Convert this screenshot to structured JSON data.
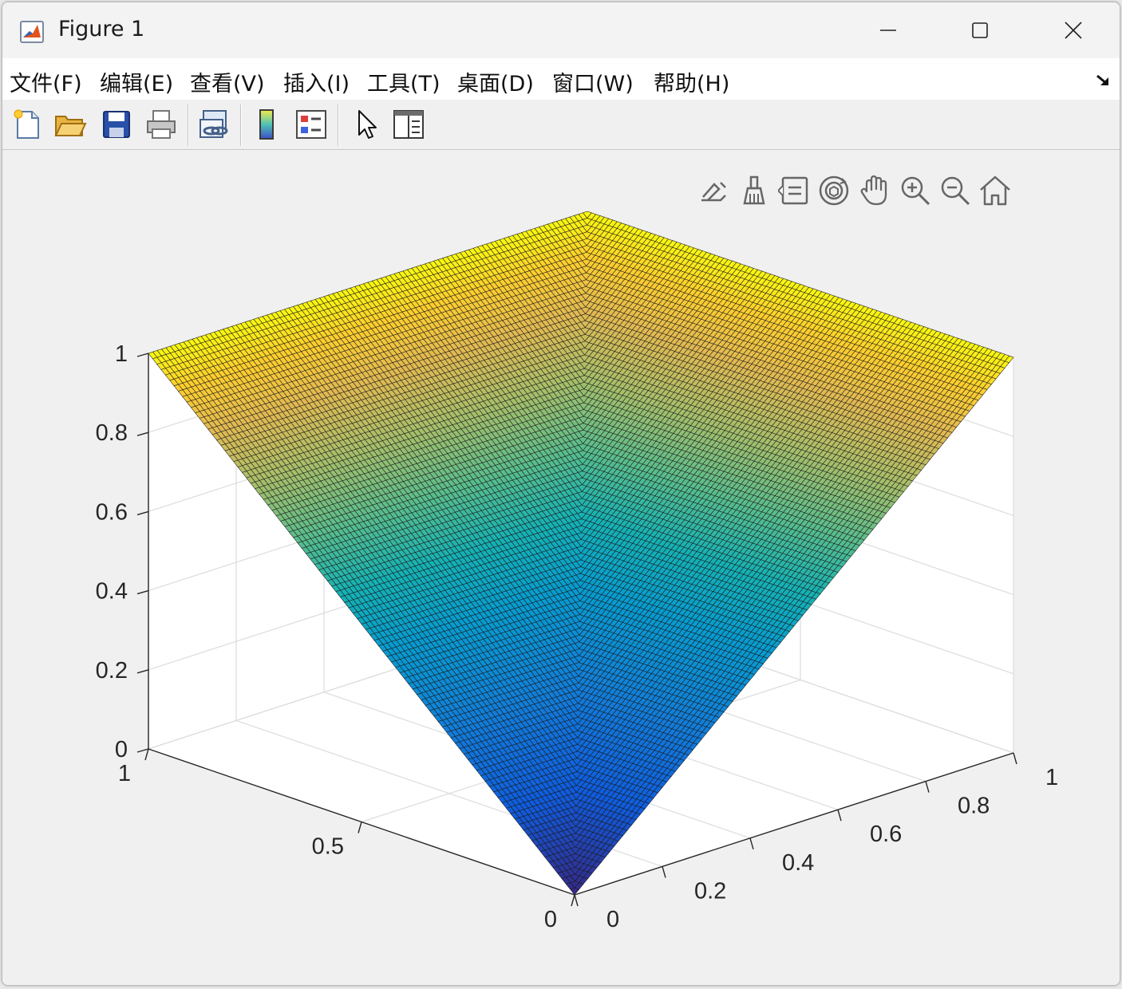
{
  "window": {
    "title": "Figure 1"
  },
  "menu": {
    "items": [
      {
        "label": "文件(F)",
        "name": "menu-file"
      },
      {
        "label": "编辑(E)",
        "name": "menu-edit"
      },
      {
        "label": "查看(V)",
        "name": "menu-view"
      },
      {
        "label": "插入(I)",
        "name": "menu-insert"
      },
      {
        "label": "工具(T)",
        "name": "menu-tools"
      },
      {
        "label": "桌面(D)",
        "name": "menu-desktop"
      },
      {
        "label": "窗口(W)",
        "name": "menu-window"
      },
      {
        "label": "帮助(H)",
        "name": "menu-help"
      }
    ]
  },
  "toolbar": {
    "icons": [
      "new-figure-icon",
      "open-file-icon",
      "save-icon",
      "print-icon",
      "link-plot-icon",
      "colorbar-icon",
      "legend-icon",
      "pointer-icon",
      "property-inspector-icon"
    ]
  },
  "axes_toolbar": {
    "icons": [
      "export-icon",
      "brush-icon",
      "data-tips-icon",
      "rotate-3d-icon",
      "pan-icon",
      "zoom-in-icon",
      "zoom-out-icon",
      "home-icon"
    ]
  },
  "chart_data": {
    "type": "surface",
    "title": "",
    "xlabel": "",
    "ylabel": "",
    "zlabel": "",
    "function": "z = max(x, y)",
    "grid": "on",
    "colormap": "parula",
    "mesh_count": 100,
    "x_range": [
      0,
      1
    ],
    "y_range": [
      0,
      1
    ],
    "zlim": [
      0,
      1
    ],
    "x_ticks": [
      {
        "value": 0,
        "label": "0"
      },
      {
        "value": 0.2,
        "label": "0.2"
      },
      {
        "value": 0.4,
        "label": "0.4"
      },
      {
        "value": 0.6,
        "label": "0.6"
      },
      {
        "value": 0.8,
        "label": "0.8"
      },
      {
        "value": 1,
        "label": "1"
      }
    ],
    "y_ticks": [
      {
        "value": 0,
        "label": "0"
      },
      {
        "value": 0.5,
        "label": "0.5"
      },
      {
        "value": 1,
        "label": "1"
      }
    ],
    "z_ticks": [
      {
        "value": 0,
        "label": "0"
      },
      {
        "value": 0.2,
        "label": "0.2"
      },
      {
        "value": 0.4,
        "label": "0.4"
      },
      {
        "value": 0.6,
        "label": "0.6"
      },
      {
        "value": 0.8,
        "label": "0.8"
      },
      {
        "value": 1,
        "label": "1"
      }
    ]
  }
}
